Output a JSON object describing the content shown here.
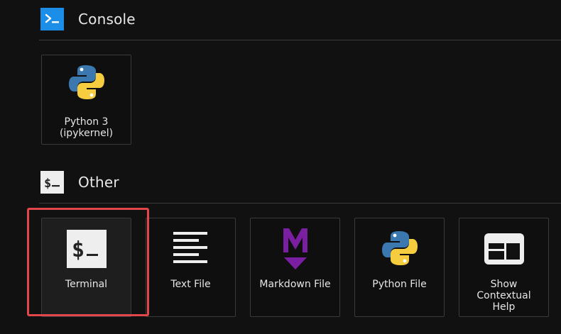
{
  "sections": {
    "console": {
      "title": "Console",
      "icon": "console-prompt-icon",
      "color": "#1d8ee8"
    },
    "other": {
      "title": "Other",
      "icon": "terminal-dollar-icon"
    }
  },
  "console_cards": [
    {
      "label_line1": "Python 3",
      "label_line2": "(ipykernel)",
      "icon": "python-logo-icon"
    }
  ],
  "other_cards": [
    {
      "label": "Terminal",
      "icon": "terminal-icon",
      "selected": true
    },
    {
      "label": "Text File",
      "icon": "text-lines-icon"
    },
    {
      "label": "Markdown File",
      "icon": "markdown-m-icon",
      "color": "#7b1fa2"
    },
    {
      "label": "Python File",
      "icon": "python-logo-icon"
    },
    {
      "label_line1": "Show",
      "label_line2": "Contextual",
      "label_line3": "Help",
      "icon": "contextual-help-icon"
    }
  ],
  "highlight_color": "#e2474b"
}
